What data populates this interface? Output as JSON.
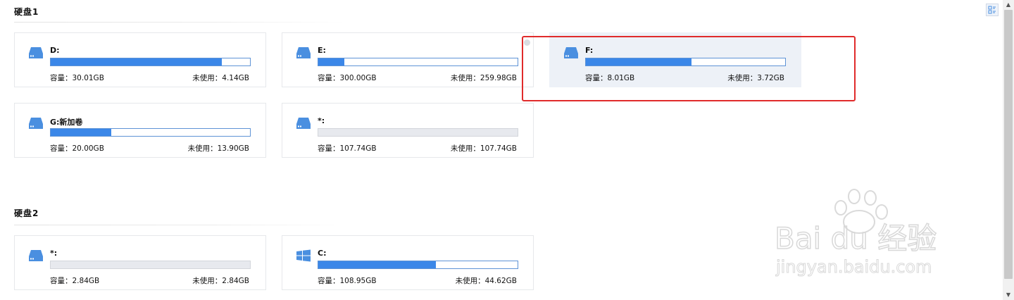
{
  "disks": [
    {
      "title": "硬盘1",
      "volumes": [
        {
          "name": "D:",
          "capacity": "容量：30.01GB",
          "unused": "未使用：4.14GB",
          "used_fraction": 0.86,
          "icon": "hard-drive-icon"
        },
        {
          "name": "E:",
          "capacity": "容量：300.00GB",
          "unused": "未使用：259.98GB",
          "used_fraction": 0.13,
          "icon": "hard-drive-icon"
        },
        {
          "name": "F:",
          "capacity": "容量：8.01GB",
          "unused": "未使用：3.72GB",
          "used_fraction": 0.53,
          "icon": "hard-drive-icon",
          "selected": true
        },
        {
          "name": "G:新加卷",
          "capacity": "容量：20.00GB",
          "unused": "未使用：13.90GB",
          "used_fraction": 0.305,
          "icon": "hard-drive-icon"
        },
        {
          "name": "*:",
          "capacity": "容量：107.74GB",
          "unused": "未使用：107.74GB",
          "used_fraction": 0,
          "icon": "hard-drive-icon"
        }
      ]
    },
    {
      "title": "硬盘2",
      "volumes": [
        {
          "name": "*:",
          "capacity": "容量：2.84GB",
          "unused": "未使用：2.84GB",
          "used_fraction": 0,
          "icon": "hard-drive-icon"
        },
        {
          "name": "C:",
          "capacity": "容量：108.95GB",
          "unused": "未使用：44.62GB",
          "used_fraction": 0.59,
          "icon": "windows-icon"
        }
      ]
    }
  ],
  "watermark": {
    "brand": "Bai du 经验",
    "url": "jingyan.baidu.com"
  },
  "colors": {
    "bar_fill": "#3b87e8",
    "bar_border": "#5e93d6",
    "selected_bg": "#edf1f7",
    "highlight_box": "#e02b2b",
    "icon": "#4a8fe0"
  }
}
